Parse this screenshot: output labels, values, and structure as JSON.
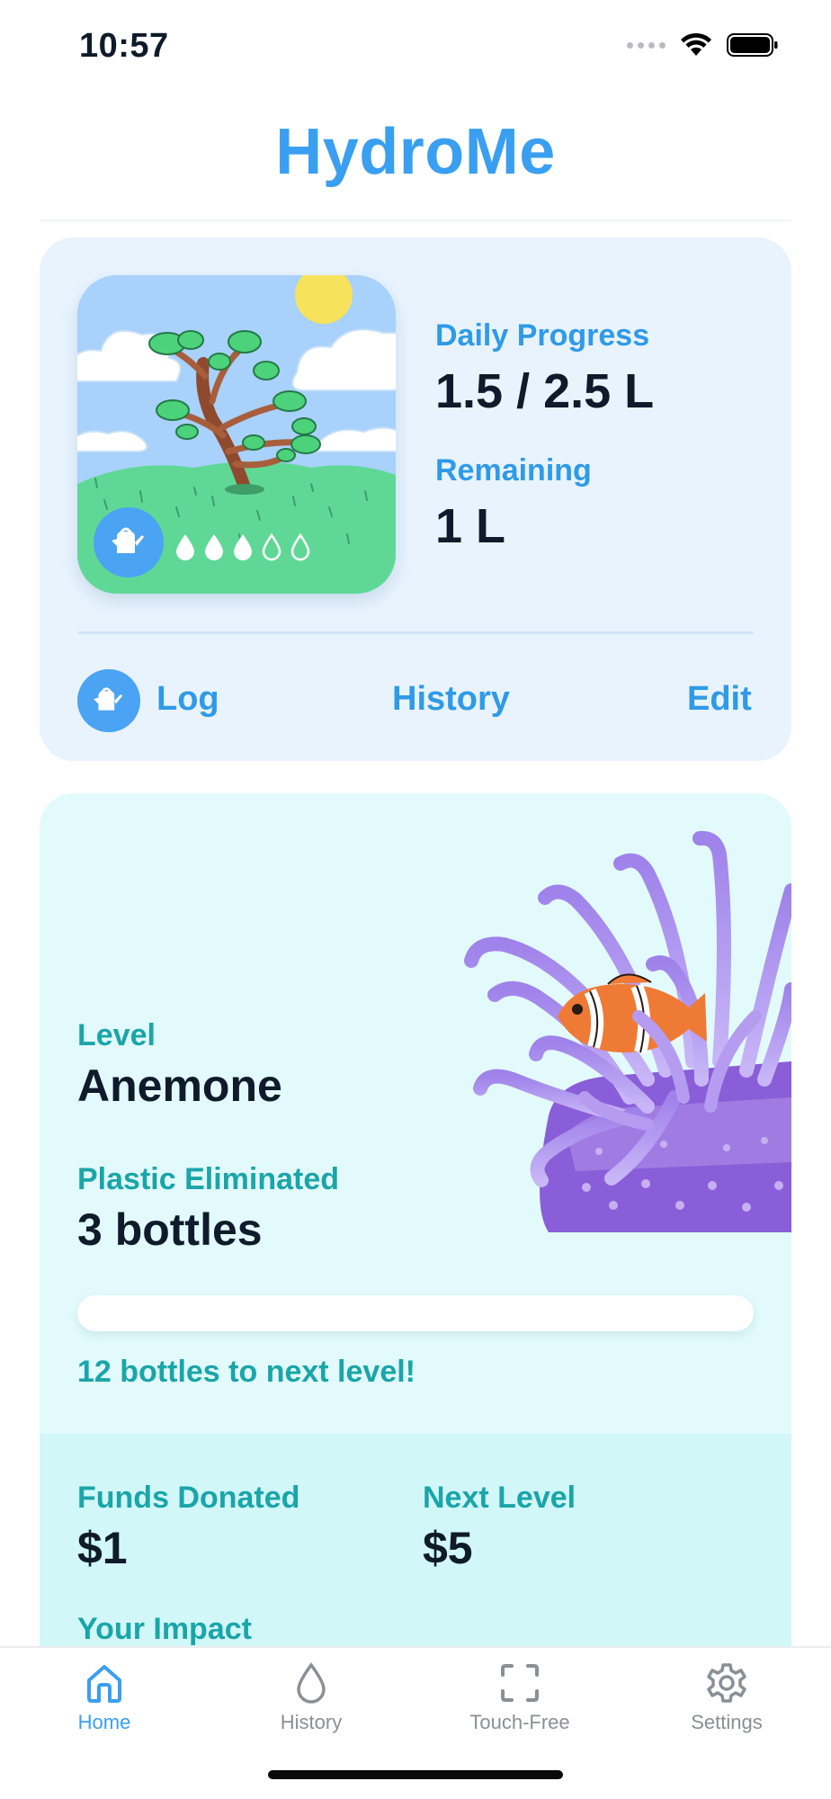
{
  "status_bar": {
    "time": "10:57",
    "icons": [
      "signal-dots-icon",
      "wifi-icon",
      "battery-icon"
    ]
  },
  "app": {
    "title": "HydroMe"
  },
  "daily": {
    "progress_label": "Daily Progress",
    "progress_value": "1.5 / 2.5 L",
    "remaining_label": "Remaining",
    "remaining_value": "1 L",
    "drops_filled": 3,
    "drops_total": 5,
    "scene": "tree-scene-illustration"
  },
  "actions": {
    "log": "Log",
    "history": "History",
    "edit": "Edit"
  },
  "impact": {
    "level_label": "Level",
    "level_value": "Anemone",
    "plastic_label": "Plastic Eliminated",
    "plastic_value": "3 bottles",
    "progress_fraction": 0,
    "next_level_note": "12 bottles to next level!",
    "funds_label": "Funds Donated",
    "funds_value": "$1",
    "next_level_label": "Next Level",
    "next_level_value": "$5",
    "your_impact_label": "Your Impact"
  },
  "tabs": [
    {
      "label": "Home",
      "icon": "home-icon",
      "active": true
    },
    {
      "label": "History",
      "icon": "drop-icon",
      "active": false
    },
    {
      "label": "Touch-Free",
      "icon": "scan-frame-icon",
      "active": false
    },
    {
      "label": "Settings",
      "icon": "gear-icon",
      "active": false
    }
  ],
  "colors": {
    "accent_blue": "#3a9ff0",
    "teal": "#1aa5a9",
    "card_blue": "#e8f3fd",
    "card_teal": "#e2fafb",
    "text_dark": "#0f1b2a"
  }
}
